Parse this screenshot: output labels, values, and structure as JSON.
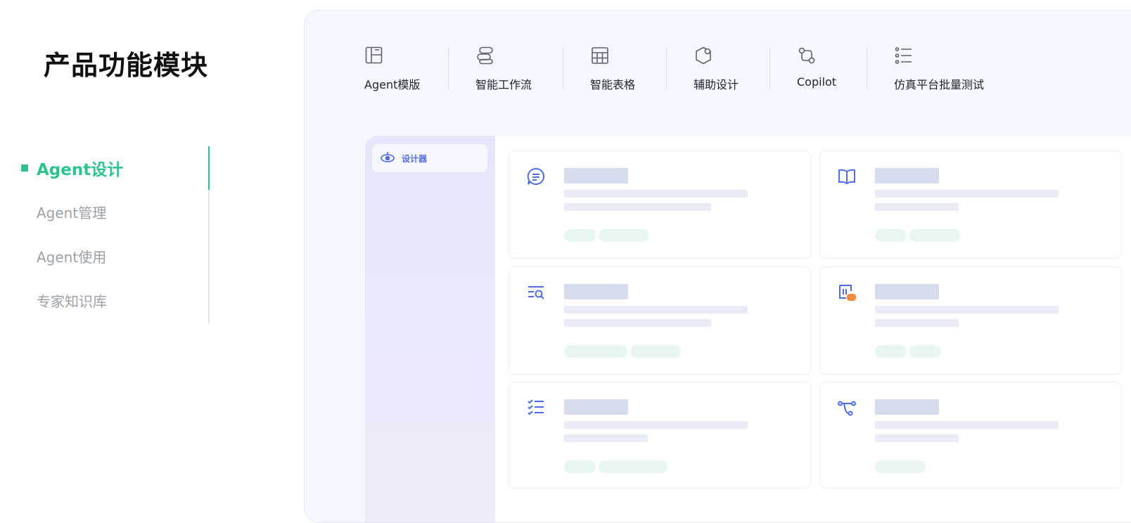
{
  "section": {
    "title": "产品功能模块"
  },
  "side_nav": {
    "items": [
      {
        "label": "Agent设计",
        "active": true
      },
      {
        "label": "Agent管理",
        "active": false
      },
      {
        "label": "Agent使用",
        "active": false
      },
      {
        "label": "专家知识库",
        "active": false
      }
    ],
    "accent_color": "#2fc28c"
  },
  "toolbar": {
    "items": [
      {
        "label": "Agent模版",
        "icon": "template-layout-icon"
      },
      {
        "label": "智能工作流",
        "icon": "workflow-icon"
      },
      {
        "label": "智能表格",
        "icon": "table-grid-icon"
      },
      {
        "label": "辅助设计",
        "icon": "hexagon-design-icon"
      },
      {
        "label": "Copilot",
        "icon": "copilot-route-icon"
      },
      {
        "label": "仿真平台批量测试",
        "icon": "checklist-icon"
      }
    ]
  },
  "app": {
    "sidebar": {
      "designer_label": "设计器",
      "designer_icon": "agent-robot-icon"
    },
    "cards": [
      {
        "icon": "chat-message-icon"
      },
      {
        "icon": "book-open-icon"
      },
      {
        "icon": "search-list-icon"
      },
      {
        "icon": "api-tool-icon"
      },
      {
        "icon": "checklist-icon"
      },
      {
        "icon": "route-branch-icon"
      }
    ],
    "brand_color": "#4f6ce6"
  }
}
